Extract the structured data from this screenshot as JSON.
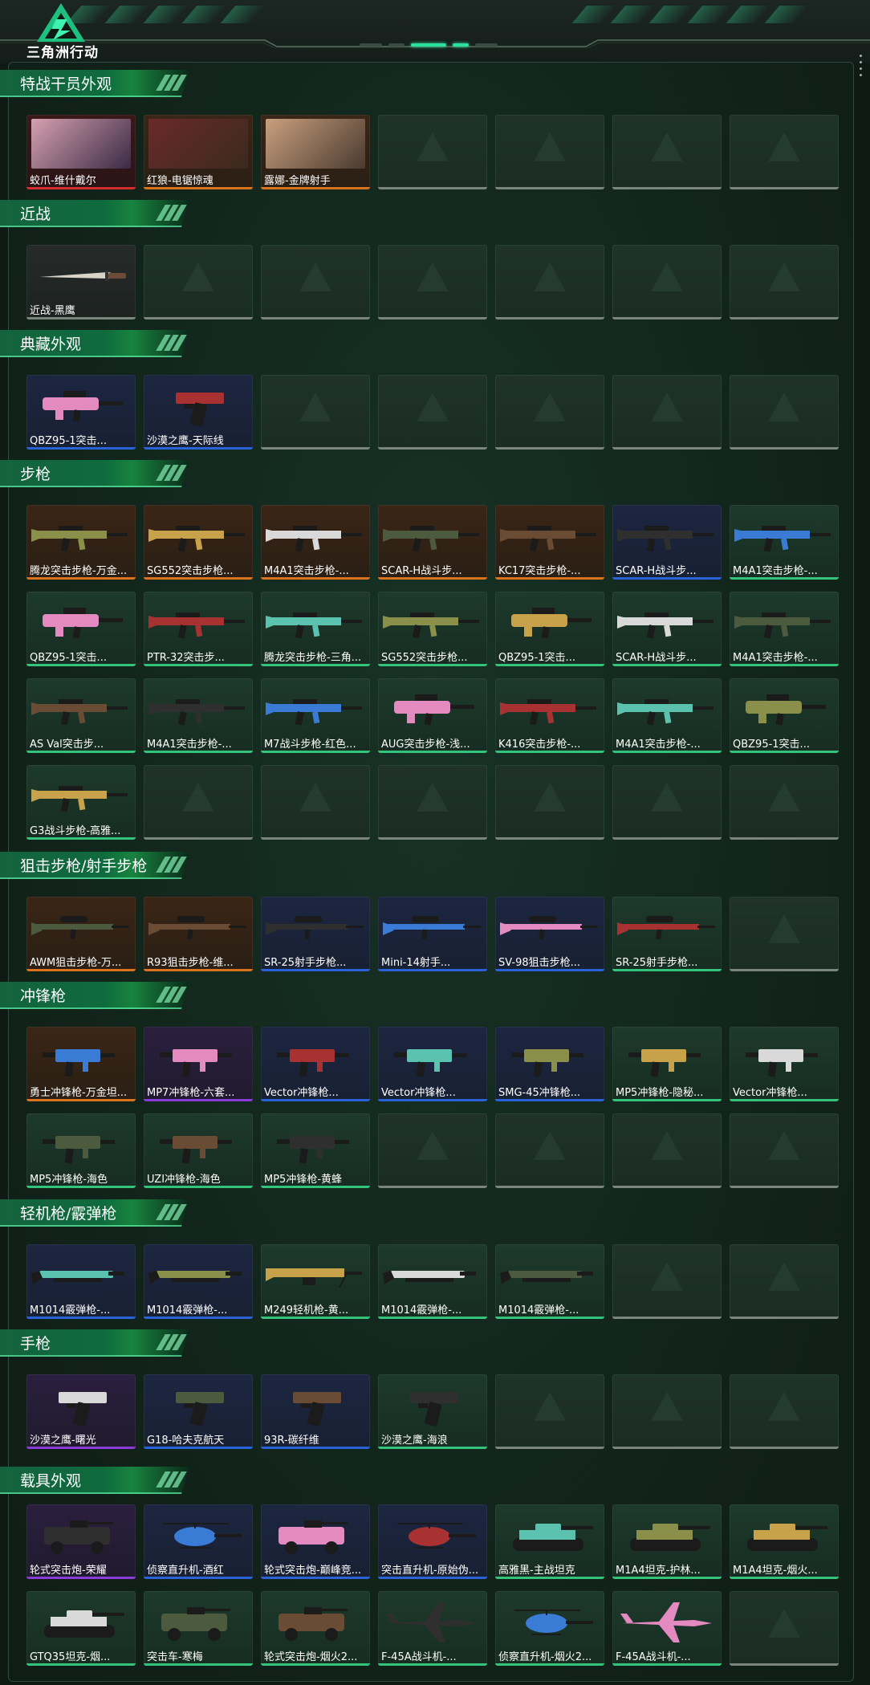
{
  "header": {
    "brand": "三角洲行动"
  },
  "colors": {
    "orange": "#d8731e",
    "red": "#d22e2e",
    "purple": "#8a3cd8",
    "blue": "#2a63d8",
    "green": "#33c37a",
    "grey": "#7a857e"
  },
  "sections": [
    {
      "title": "特战干员外观",
      "items": [
        {
          "name": "蛟爪-维什戴尔",
          "rarity": "red",
          "kind": "operator"
        },
        {
          "name": "红狼-电锯惊魂",
          "rarity": "orange",
          "kind": "operator"
        },
        {
          "name": "露娜-金牌射手",
          "rarity": "orange",
          "kind": "operator"
        }
      ]
    },
    {
      "title": "近战",
      "items": [
        {
          "name": "近战-黑鹰",
          "rarity": "grey",
          "kind": "knife"
        }
      ]
    },
    {
      "title": "典藏外观",
      "items": [
        {
          "name": "QBZ95-1突击...",
          "rarity": "blue",
          "kind": "bullpup"
        },
        {
          "name": "沙漠之鹰-天际线",
          "rarity": "blue",
          "kind": "pistol"
        }
      ]
    },
    {
      "title": "步枪",
      "items": [
        {
          "name": "腾龙突击步枪-万金...",
          "rarity": "orange",
          "kind": "rifle"
        },
        {
          "name": "SG552突击步枪...",
          "rarity": "orange",
          "kind": "rifle"
        },
        {
          "name": "M4A1突击步枪-...",
          "rarity": "orange",
          "kind": "rifle"
        },
        {
          "name": "SCAR-H战斗步...",
          "rarity": "orange",
          "kind": "rifle"
        },
        {
          "name": "KC17突击步枪-...",
          "rarity": "orange",
          "kind": "rifle"
        },
        {
          "name": "SCAR-H战斗步...",
          "rarity": "blue",
          "kind": "rifle"
        },
        {
          "name": "M4A1突击步枪-...",
          "rarity": "green",
          "kind": "rifle"
        },
        {
          "name": "QBZ95-1突击...",
          "rarity": "green",
          "kind": "bullpup"
        },
        {
          "name": "PTR-32突击步...",
          "rarity": "green",
          "kind": "rifle"
        },
        {
          "name": "腾龙突击步枪-三角...",
          "rarity": "green",
          "kind": "rifle"
        },
        {
          "name": "SG552突击步枪...",
          "rarity": "green",
          "kind": "rifle"
        },
        {
          "name": "QBZ95-1突击...",
          "rarity": "green",
          "kind": "bullpup"
        },
        {
          "name": "SCAR-H战斗步...",
          "rarity": "green",
          "kind": "rifle"
        },
        {
          "name": "M4A1突击步枪-...",
          "rarity": "green",
          "kind": "rifle"
        },
        {
          "name": "AS Val突击步...",
          "rarity": "green",
          "kind": "rifle"
        },
        {
          "name": "M4A1突击步枪-...",
          "rarity": "green",
          "kind": "rifle"
        },
        {
          "name": "M7战斗步枪-红色...",
          "rarity": "green",
          "kind": "rifle"
        },
        {
          "name": "AUG突击步枪-浅...",
          "rarity": "green",
          "kind": "bullpup"
        },
        {
          "name": "K416突击步枪-...",
          "rarity": "green",
          "kind": "rifle"
        },
        {
          "name": "M4A1突击步枪-...",
          "rarity": "green",
          "kind": "rifle"
        },
        {
          "name": "QBZ95-1突击...",
          "rarity": "green",
          "kind": "bullpup"
        },
        {
          "name": "G3战斗步枪-高雅...",
          "rarity": "green",
          "kind": "rifle"
        }
      ]
    },
    {
      "title": "狙击步枪/射手步枪",
      "items": [
        {
          "name": "AWM狙击步枪-万...",
          "rarity": "orange",
          "kind": "sniper"
        },
        {
          "name": "R93狙击步枪-维...",
          "rarity": "orange",
          "kind": "sniper"
        },
        {
          "name": "SR-25射手步枪...",
          "rarity": "blue",
          "kind": "sniper"
        },
        {
          "name": "Mini-14射手...",
          "rarity": "blue",
          "kind": "sniper"
        },
        {
          "name": "SV-98狙击步枪...",
          "rarity": "blue",
          "kind": "sniper"
        },
        {
          "name": "SR-25射手步枪...",
          "rarity": "green",
          "kind": "sniper"
        }
      ]
    },
    {
      "title": "冲锋枪",
      "items": [
        {
          "name": "勇士冲锋枪-万金坦...",
          "rarity": "orange",
          "kind": "smg"
        },
        {
          "name": "MP7冲锋枪-六套...",
          "rarity": "purple",
          "kind": "smg"
        },
        {
          "name": "Vector冲锋枪...",
          "rarity": "blue",
          "kind": "smg"
        },
        {
          "name": "Vector冲锋枪...",
          "rarity": "blue",
          "kind": "smg"
        },
        {
          "name": "SMG-45冲锋枪...",
          "rarity": "blue",
          "kind": "smg"
        },
        {
          "name": "MP5冲锋枪-隐秘...",
          "rarity": "green",
          "kind": "smg"
        },
        {
          "name": "Vector冲锋枪...",
          "rarity": "green",
          "kind": "smg"
        },
        {
          "name": "MP5冲锋枪-海色",
          "rarity": "green",
          "kind": "smg"
        },
        {
          "name": "UZI冲锋枪-海色",
          "rarity": "green",
          "kind": "smg"
        },
        {
          "name": "MP5冲锋枪-黄蜂",
          "rarity": "green",
          "kind": "smg"
        }
      ]
    },
    {
      "title": "轻机枪/霰弹枪",
      "items": [
        {
          "name": "M1014霰弹枪-...",
          "rarity": "blue",
          "kind": "shotgun"
        },
        {
          "name": "M1014霰弹枪-...",
          "rarity": "blue",
          "kind": "shotgun"
        },
        {
          "name": "M249轻机枪-黄...",
          "rarity": "green",
          "kind": "lmg"
        },
        {
          "name": "M1014霰弹枪-...",
          "rarity": "green",
          "kind": "shotgun"
        },
        {
          "name": "M1014霰弹枪-...",
          "rarity": "green",
          "kind": "shotgun"
        }
      ]
    },
    {
      "title": "手枪",
      "items": [
        {
          "name": "沙漠之鹰-曙光",
          "rarity": "purple",
          "kind": "pistol"
        },
        {
          "name": "G18-哈夫克航天",
          "rarity": "blue",
          "kind": "pistol"
        },
        {
          "name": "93R-碳纤维",
          "rarity": "blue",
          "kind": "pistol"
        },
        {
          "name": "沙漠之鹰-海浪",
          "rarity": "green",
          "kind": "pistol"
        }
      ]
    },
    {
      "title": "载具外观",
      "items": [
        {
          "name": "轮式突击炮-荣耀",
          "rarity": "purple",
          "kind": "apc"
        },
        {
          "name": "侦察直升机-酒红",
          "rarity": "blue",
          "kind": "heli"
        },
        {
          "name": "轮式突击炮-巅峰竞...",
          "rarity": "blue",
          "kind": "apc"
        },
        {
          "name": "突击直升机-原始伪...",
          "rarity": "blue",
          "kind": "heli"
        },
        {
          "name": "高雅黑-主战坦克",
          "rarity": "green",
          "kind": "tank"
        },
        {
          "name": "M1A4坦克-护林...",
          "rarity": "green",
          "kind": "tank"
        },
        {
          "name": "M1A4坦克-烟火...",
          "rarity": "green",
          "kind": "tank"
        },
        {
          "name": "GTQ35坦克-烟...",
          "rarity": "green",
          "kind": "tank"
        },
        {
          "name": "突击车-寒梅",
          "rarity": "green",
          "kind": "apc"
        },
        {
          "name": "轮式突击炮-烟火2...",
          "rarity": "green",
          "kind": "apc"
        },
        {
          "name": "F-45A战斗机-...",
          "rarity": "green",
          "kind": "jet"
        },
        {
          "name": "侦察直升机-烟火2...",
          "rarity": "green",
          "kind": "heli"
        },
        {
          "name": "F-45A战斗机-...",
          "rarity": "green",
          "kind": "jet"
        }
      ]
    }
  ]
}
